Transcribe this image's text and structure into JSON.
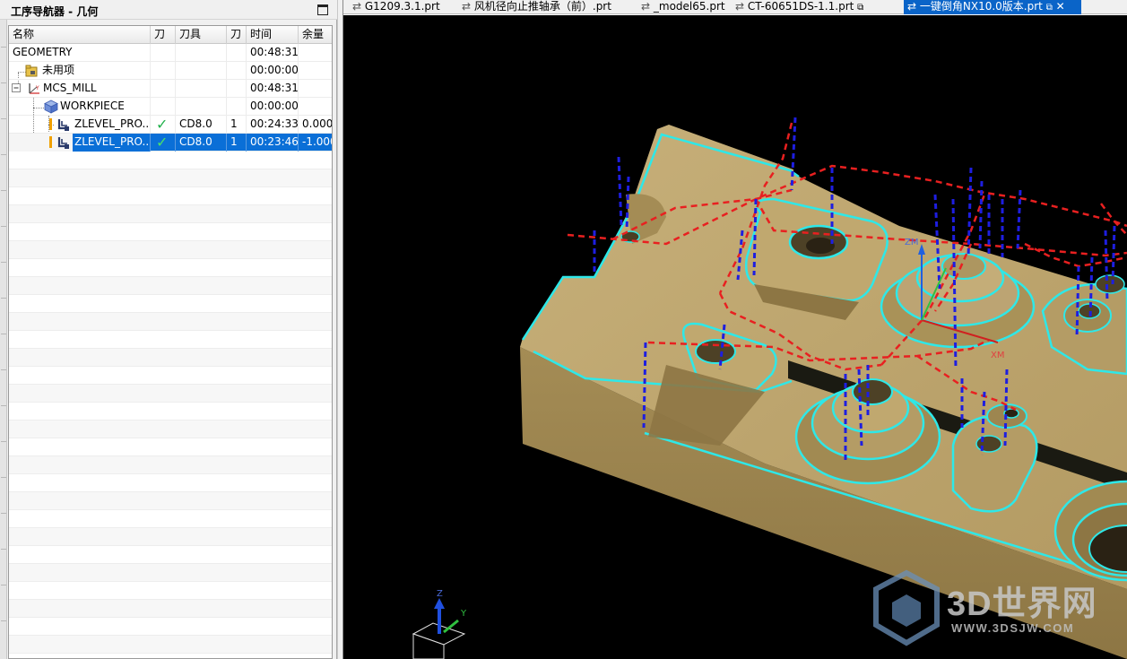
{
  "navigator": {
    "title": "工序导航器 - 几何",
    "columns": [
      "名称",
      "刀",
      "刀具",
      "刀",
      "时间",
      "余量"
    ],
    "rows": [
      {
        "name": "GEOMETRY",
        "check": "",
        "tool": "",
        "num": "",
        "time": "00:48:31",
        "stock": ""
      },
      {
        "name": "未用项",
        "check": "",
        "tool": "",
        "num": "",
        "time": "00:00:00",
        "stock": ""
      },
      {
        "name": "MCS_MILL",
        "check": "",
        "tool": "",
        "num": "",
        "time": "00:48:31",
        "stock": ""
      },
      {
        "name": "WORKPIECE",
        "check": "",
        "tool": "",
        "num": "",
        "time": "00:00:00",
        "stock": ""
      },
      {
        "name": "ZLEVEL_PRO...",
        "check": "✓",
        "tool": "CD8.0",
        "num": "1",
        "time": "00:24:33",
        "stock": "0.0000"
      },
      {
        "name": "ZLEVEL_PRO...",
        "check": "✓",
        "tool": "CD8.0",
        "num": "1",
        "time": "00:23:46",
        "stock": "-1.000"
      }
    ],
    "selected_row": 5
  },
  "tabs": [
    {
      "label": "G1209.3.1.prt",
      "active": false
    },
    {
      "label": "风机径向止推轴承（前）.prt",
      "active": false
    },
    {
      "label": "_model65.prt",
      "active": false
    },
    {
      "label": "CT-60651DS-1.1.prt",
      "active": false
    },
    {
      "label": "一键倒角NX10.0版本.prt",
      "active": true
    }
  ],
  "viewport": {
    "axis_labels": {
      "zm": "ZM",
      "xm": "XM",
      "z": "Z",
      "y": "Y"
    },
    "watermark": {
      "brand": "3D世界网",
      "url": "WWW.3DSJW.COM"
    }
  },
  "colors": {
    "accent_selected": "#0A6FD7",
    "check_green": "#22B14C",
    "part_fill": "#B9A26A",
    "contour_cyan": "#2EE8E8",
    "toolpath_red": "#E82020",
    "toolpath_blue": "#1E1EE0"
  }
}
